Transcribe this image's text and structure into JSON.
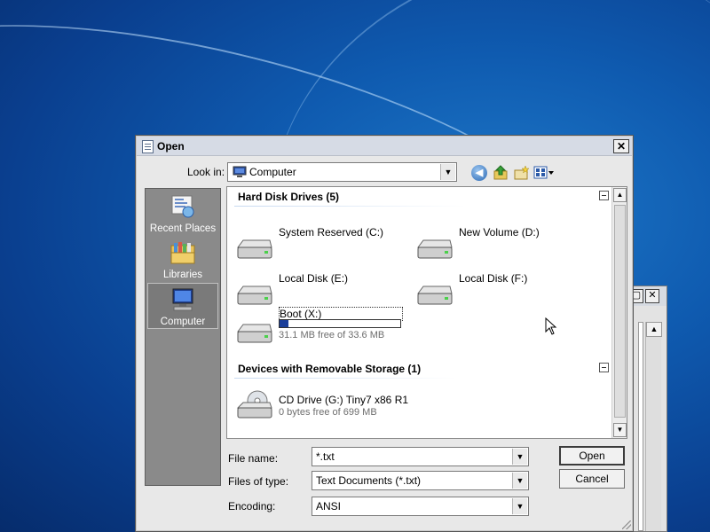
{
  "colors": {
    "desktop": "#0f5bb0",
    "dialog_bg": "#e8e8e8",
    "places_bg": "#8a8a8a",
    "capacity_fill": "#1c3f9a"
  },
  "dialog": {
    "title": "Open",
    "close_glyph": "✕"
  },
  "look_in": {
    "label": "Look in:",
    "value": "Computer",
    "icon": "computer-icon"
  },
  "toolbar": {
    "back_icon": "back-arrow-icon",
    "up_icon": "up-folder-icon",
    "new_folder_icon": "new-folder-icon",
    "views_icon": "view-menu-icon"
  },
  "places": [
    {
      "label": "Recent Places",
      "icon": "recent-places-icon"
    },
    {
      "label": "Libraries",
      "icon": "libraries-icon"
    },
    {
      "label": "Computer",
      "icon": "computer-icon",
      "active": true
    }
  ],
  "groups": {
    "hard_disks": {
      "header": "Hard Disk Drives (5)",
      "drives": [
        {
          "name": "System Reserved (C:)"
        },
        {
          "name": "New Volume (D:)"
        },
        {
          "name": "Local Disk (E:)"
        },
        {
          "name": "Local Disk (F:)"
        },
        {
          "name": "Boot (X:)",
          "free_text": "31.1 MB free of 33.6 MB",
          "used_fraction": 0.07
        }
      ]
    },
    "removable": {
      "header": "Devices with Removable Storage (1)",
      "drives": [
        {
          "name": "CD Drive (G:) Tiny7 x86 R1",
          "free_text": "0 bytes free of 699 MB"
        }
      ]
    }
  },
  "fields": {
    "file_name": {
      "label": "File name:",
      "value": "*.txt"
    },
    "file_type": {
      "label": "Files of type:",
      "value": "Text Documents (*.txt)"
    },
    "encoding": {
      "label": "Encoding:",
      "value": "ANSI"
    }
  },
  "buttons": {
    "open": "Open",
    "cancel": "Cancel"
  }
}
